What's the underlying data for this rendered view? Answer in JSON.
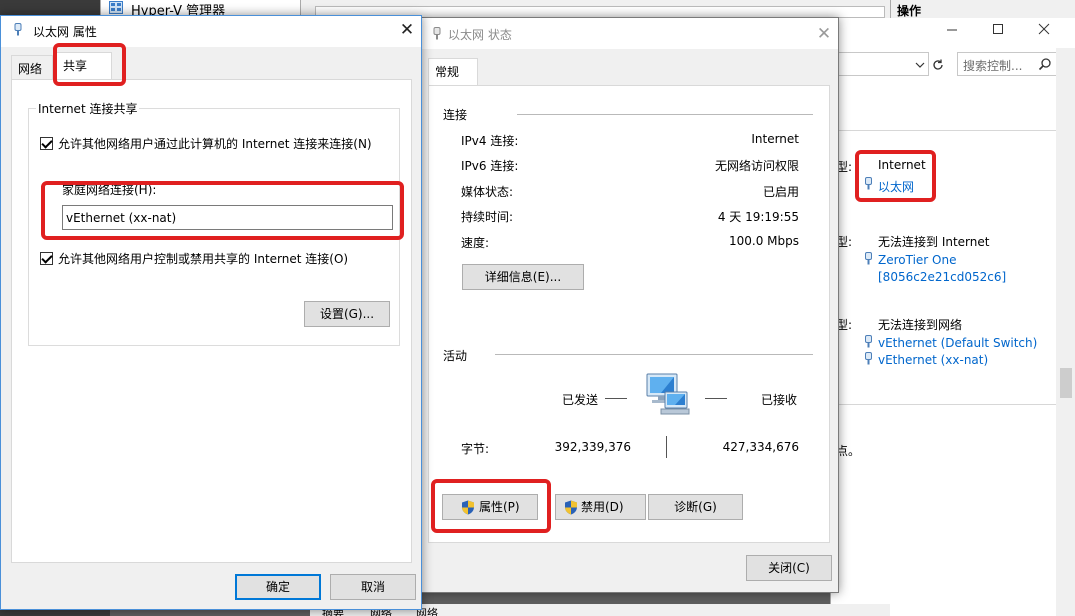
{
  "hyperv": {
    "title": "Hyper-V 管理器",
    "actions_header": "操作",
    "search_placeholder": "搜索控制...",
    "bottom_tabs": [
      "摘要",
      "网络",
      "网络"
    ],
    "panel": {
      "row1_label": "型:",
      "row1_value": "Internet",
      "row1_link": "以太网",
      "row2_label": "型:",
      "row2_value": "无法连接到 Internet",
      "row2_link1": "ZeroTier One",
      "row2_link2": "[8056c2e21cd052c6]",
      "row3_label": "型:",
      "row3_value": "无法连接到网络",
      "row3_link1": "vEthernet (Default Switch)",
      "row3_link2": "vEthernet (xx-nat)",
      "trailing": "点。"
    }
  },
  "properties": {
    "title": "以太网 属性",
    "tabs": [
      "网络",
      "共享"
    ],
    "group_title": "Internet 连接共享",
    "check1": "允许其他网络用户通过此计算机的 Internet 连接来连接(N)",
    "home_label": "家庭网络连接(H):",
    "home_value": "vEthernet (xx-nat)",
    "check2": "允许其他网络用户控制或禁用共享的 Internet 连接(O)",
    "settings_button": "设置(G)...",
    "ok_button": "确定",
    "cancel_button": "取消"
  },
  "status": {
    "title": "以太网 状态",
    "tab": "常规",
    "connection_header": "连接",
    "rows": [
      {
        "label": "IPv4 连接:",
        "value": "Internet"
      },
      {
        "label": "IPv6 连接:",
        "value": "无网络访问权限"
      },
      {
        "label": "媒体状态:",
        "value": "已启用"
      },
      {
        "label": "持续时间:",
        "value": "4 天 19:19:55"
      },
      {
        "label": "速度:",
        "value": "100.0 Mbps"
      }
    ],
    "details_button": "详细信息(E)...",
    "activity_header": "活动",
    "sent_label": "已发送",
    "received_label": "已接收",
    "bytes_label": "字节:",
    "bytes_sent": "392,339,376",
    "bytes_received": "427,334,676",
    "properties_button": "属性(P)",
    "disable_button": "禁用(D)",
    "diagnose_button": "诊断(G)",
    "close_button": "关闭(C)"
  }
}
